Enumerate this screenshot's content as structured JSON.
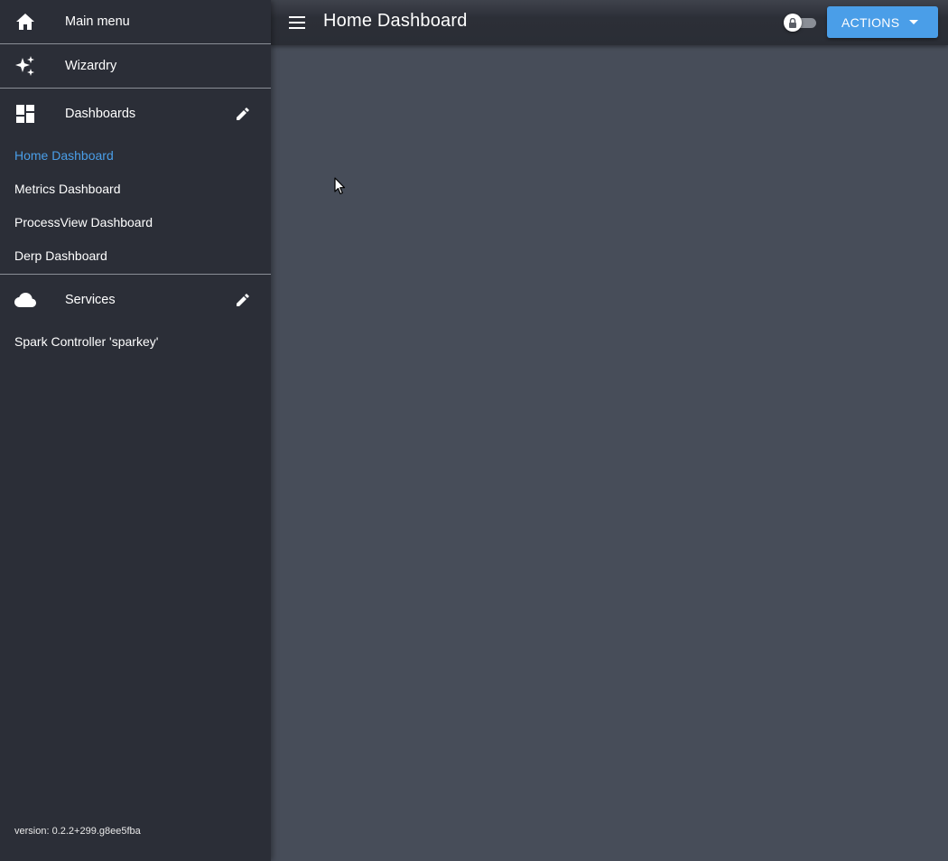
{
  "sidebar": {
    "main_menu": {
      "label": "Main menu",
      "icon": "home-icon"
    },
    "wizardry": {
      "label": "Wizardry",
      "icon": "sparkles-icon"
    },
    "dashboards": {
      "label": "Dashboards",
      "icon": "dashboard-icon",
      "edit_icon": "pencil-icon",
      "items": [
        {
          "label": "Home Dashboard",
          "active": true
        },
        {
          "label": "Metrics Dashboard",
          "active": false
        },
        {
          "label": "ProcessView Dashboard",
          "active": false
        },
        {
          "label": "Derp Dashboard",
          "active": false
        }
      ]
    },
    "services": {
      "label": "Services",
      "icon": "cloud-icon",
      "edit_icon": "pencil-icon",
      "items": [
        {
          "label": "Spark Controller 'sparkey'"
        }
      ]
    },
    "version": "version: 0.2.2+299.g8ee5fba"
  },
  "topbar": {
    "menu_icon": "hamburger-icon",
    "title": "Home Dashboard",
    "lock_toggle": {
      "icon": "lock-icon",
      "checked": false
    },
    "actions_label": "ACTIONS",
    "actions_icon": "caret-down-icon"
  },
  "colors": {
    "sidebar_bg": "#2b2e37",
    "content_bg": "#474d59",
    "accent": "#4a9ee8",
    "divider": "#8a8e96"
  }
}
